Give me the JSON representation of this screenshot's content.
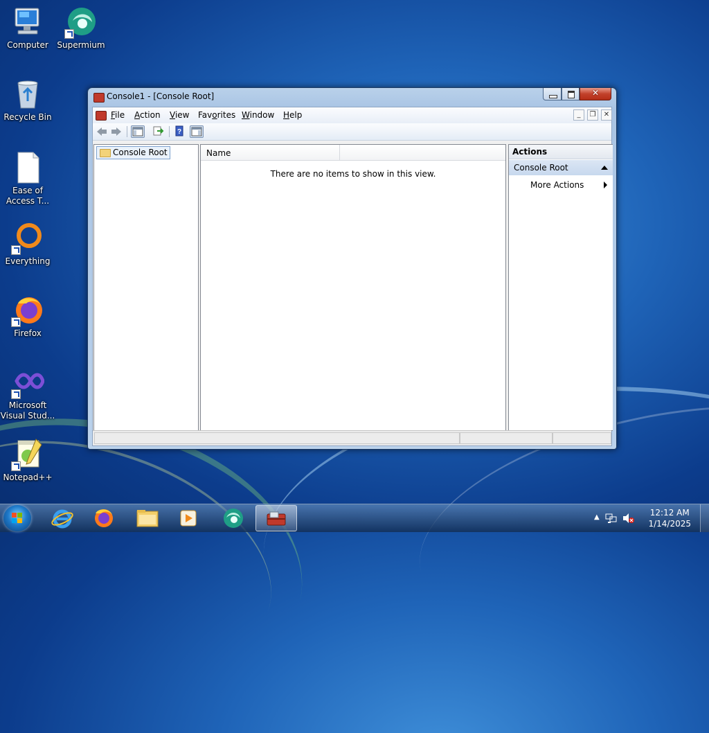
{
  "desktop": {
    "icons": [
      {
        "label": "Computer"
      },
      {
        "label": "Supermium"
      },
      {
        "label": "Recycle Bin"
      },
      {
        "label": "Ease of Access T..."
      },
      {
        "label": "Everything"
      },
      {
        "label": "Firefox"
      },
      {
        "label": "Microsoft Visual Stud..."
      },
      {
        "label": "Notepad++"
      }
    ]
  },
  "window": {
    "title": "Console1 - [Console Root]",
    "menu": {
      "file": {
        "accel": "F",
        "rest": "ile"
      },
      "action": {
        "accel": "A",
        "rest": "ction"
      },
      "view": {
        "accel": "V",
        "rest": "iew"
      },
      "favorites": {
        "pre": "Fav",
        "accel": "o",
        "rest": "rites"
      },
      "window": {
        "accel": "W",
        "rest": "indow"
      },
      "help": {
        "accel": "H",
        "rest": "elp"
      }
    },
    "tree": {
      "root_label": "Console Root"
    },
    "list": {
      "column_name": "Name",
      "empty_message": "There are no items to show in this view."
    },
    "actions": {
      "header": "Actions",
      "group_label": "Console Root",
      "item_label": "More Actions"
    }
  },
  "taskbar": {
    "apps": [
      "internet-explorer",
      "firefox",
      "file-explorer",
      "media-player",
      "supermium",
      "mmc-console"
    ],
    "clock": {
      "time": "12:12 AM",
      "date": "1/14/2025"
    }
  }
}
